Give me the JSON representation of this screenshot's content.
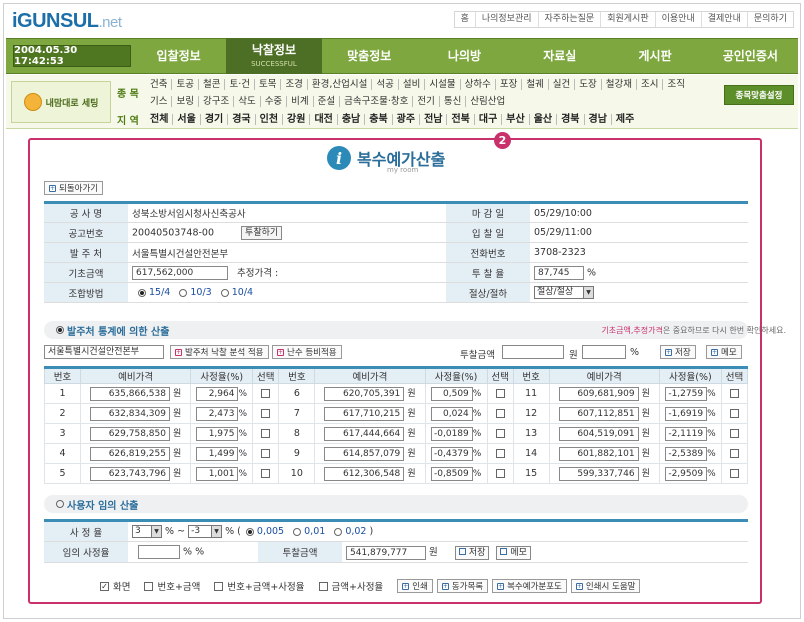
{
  "logo": {
    "main": "iGUNSUL",
    "suffix": ".net"
  },
  "toplinks": [
    "홈",
    "나의정보관리",
    "자주하는질문",
    "회원게시판",
    "이용안내",
    "결제안내",
    "문의하기"
  ],
  "datetime": "2004.05.30 17:42:53",
  "nav": [
    {
      "label": "입찰정보"
    },
    {
      "label": "낙찰정보",
      "sub": "SUCCESSFUL",
      "active": true
    },
    {
      "label": "맞춤정보"
    },
    {
      "label": "나의방"
    },
    {
      "label": "자료실"
    },
    {
      "label": "게시판"
    },
    {
      "label": "공인인증서"
    }
  ],
  "mymenu": "내맘대로 세팅",
  "category": {
    "type_label": "종 목",
    "region_label": "지 역",
    "row1": [
      "건축",
      "토공",
      "철콘",
      "토·건",
      "토목",
      "조경",
      "환경,산업시설",
      "석공",
      "설비",
      "시설물",
      "상하수",
      "포장",
      "철궤",
      "실건",
      "도장",
      "철강재",
      "조시",
      "조직"
    ],
    "row2": [
      "기스",
      "보링",
      "강구조",
      "삭도",
      "수중",
      "비계",
      "준설",
      "금속구조물·창호",
      "전기",
      "통신",
      "산림산업"
    ],
    "regions": [
      "전체",
      "서울",
      "경기",
      "경국",
      "인천",
      "강원",
      "대전",
      "충남",
      "충북",
      "광주",
      "전남",
      "전북",
      "대구",
      "부산",
      "울산",
      "경북",
      "경남",
      "제주"
    ],
    "set_button": "종목맞춤설정"
  },
  "panel": {
    "badge": "2",
    "title": "복수예가산출",
    "subtitle": "my room",
    "back_button": "되돌아가기"
  },
  "info": {
    "project_label": "공 사 명",
    "project": "성북소방서임시청사신축공사",
    "deadline_label": "마 감 일",
    "deadline": "05/29/10:00",
    "notice_label": "공고번호",
    "notice": "20040503748-00",
    "notice_button": "투찰하기",
    "bid_date_label": "입 찰 일",
    "bid_date": "05/29/11:00",
    "orderer_label": "발 주 처",
    "orderer": "서울특별시건설안전본부",
    "phone_label": "전화번호",
    "phone": "3708-2323",
    "base_label": "기초금액",
    "base": "617,562,000",
    "estimate_label": "추정가격 :",
    "bid_rate_label": "투 찰 율",
    "bid_rate": "87,745",
    "bid_rate_unit": "%",
    "method_label": "조합방법",
    "methods": [
      "15/4",
      "10/3",
      "10/4"
    ],
    "cut_label": "절상/절하",
    "cut": "절상/절상"
  },
  "sec1": {
    "title": "발주처 통계에 의한 산출",
    "note_highlight": "기초금액,추정가격",
    "note_rest": "은 중요하므로 다시 한번 확인하세요.",
    "orderer_value": "서울특별시건설안전본부",
    "btn_analysis": "발주처 낙찰 분석 적용",
    "btn_random": "난수 등비적용",
    "amount_label": "투찰금액",
    "won": "원",
    "pct": "%",
    "btn_save": "저장",
    "btn_memo": "메모"
  },
  "grid": {
    "headers": [
      "번호",
      "예비가격",
      "사정율(%)",
      "선택"
    ],
    "won": "원",
    "pct": "%",
    "rows": [
      {
        "no": "1",
        "price": "635,866,538",
        "rate": "2,964"
      },
      {
        "no": "2",
        "price": "632,834,309",
        "rate": "2,473"
      },
      {
        "no": "3",
        "price": "629,758,850",
        "rate": "1,975"
      },
      {
        "no": "4",
        "price": "626,819,255",
        "rate": "1,499"
      },
      {
        "no": "5",
        "price": "623,743,796",
        "rate": "1,001"
      },
      {
        "no": "6",
        "price": "620,705,391",
        "rate": "0,509"
      },
      {
        "no": "7",
        "price": "617,710,215",
        "rate": "0,024"
      },
      {
        "no": "8",
        "price": "617,444,664",
        "rate": "-0,0189"
      },
      {
        "no": "9",
        "price": "614,857,079",
        "rate": "-0,4379"
      },
      {
        "no": "10",
        "price": "612,306,548",
        "rate": "-0,8509"
      },
      {
        "no": "11",
        "price": "609,681,909",
        "rate": "-1,2759"
      },
      {
        "no": "12",
        "price": "607,112,851",
        "rate": "-1,6919"
      },
      {
        "no": "13",
        "price": "604,519,091",
        "rate": "-2,1119"
      },
      {
        "no": "14",
        "price": "601,882,101",
        "rate": "-2,5389"
      },
      {
        "no": "15",
        "price": "599,337,746",
        "rate": "-2,9509"
      }
    ]
  },
  "sec2": {
    "title": "사용자 임의 산출",
    "rate_label": "사 정 율",
    "rate_from": "3",
    "rate_to": "-3",
    "tilde": "% ~",
    "pct_open": "% (",
    "steps": [
      "0,005",
      "0,01",
      "0,02"
    ],
    "close": ")",
    "custom_label": "임의 사정율",
    "pct2": "% %",
    "amount_label": "투찰금액",
    "amount": "541,879,777",
    "won": "원",
    "btn_save": "저장",
    "btn_memo": "메모"
  },
  "options": {
    "checks": [
      {
        "label": "화면",
        "checked": true
      },
      {
        "label": "번호+금액",
        "checked": false
      },
      {
        "label": "번호+금액+사정율",
        "checked": false
      },
      {
        "label": "금액+사정율",
        "checked": false
      }
    ],
    "buttons": [
      "인쇄",
      "동가목록",
      "복수예가분포도",
      "인쇄시 도움말"
    ]
  }
}
